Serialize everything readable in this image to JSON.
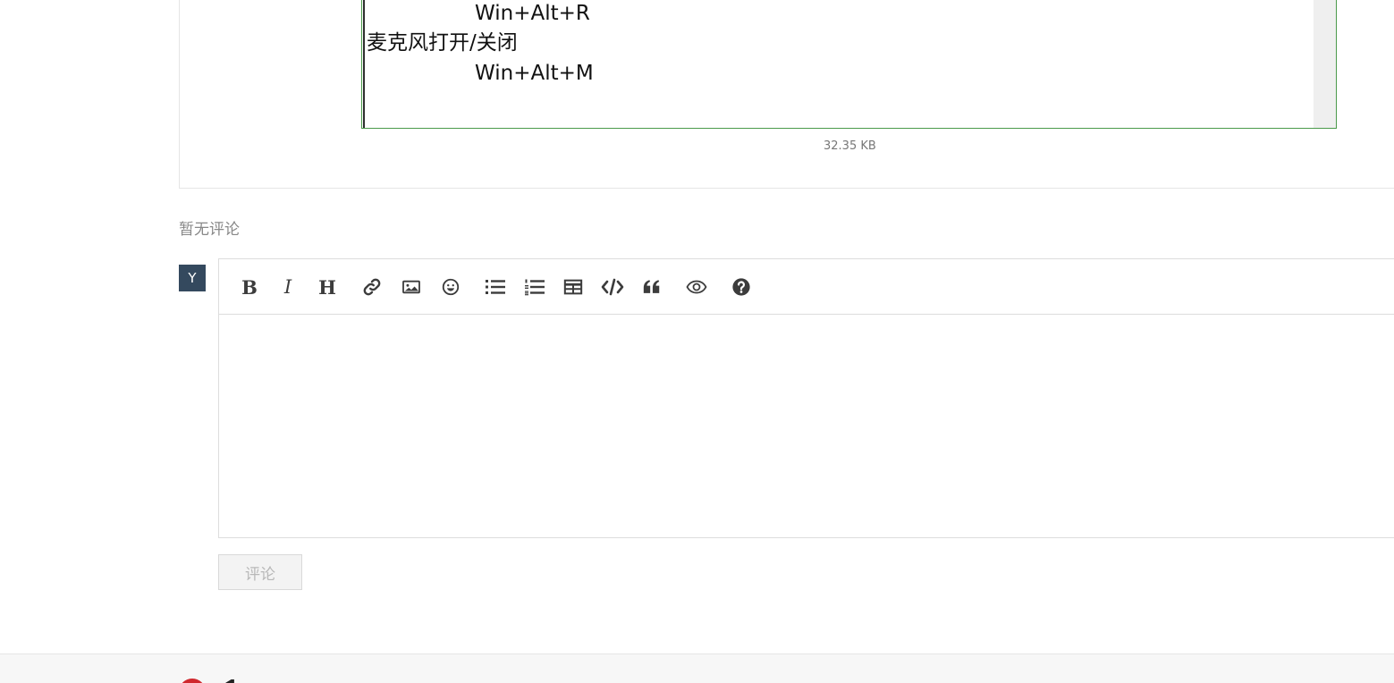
{
  "post": {
    "attachment_lines": {
      "line1": "Win+Alt+R",
      "line2": "麦克风打开/关闭",
      "line3": "Win+Alt+M"
    },
    "file_size": "32.35 KB"
  },
  "comments": {
    "empty_text": "暂无评论"
  },
  "composer": {
    "avatar_letter": "Y",
    "toolbar": [
      {
        "name": "bold-icon",
        "glyph": "B"
      },
      {
        "name": "italic-icon",
        "glyph": "I"
      },
      {
        "name": "heading-icon",
        "glyph": "H"
      },
      {
        "name": "link-icon"
      },
      {
        "name": "image-icon"
      },
      {
        "name": "emoji-icon"
      },
      {
        "name": "bullet-list-icon"
      },
      {
        "name": "numbered-list-icon"
      },
      {
        "name": "table-icon"
      },
      {
        "name": "code-icon"
      },
      {
        "name": "quote-icon"
      },
      {
        "name": "preview-icon"
      },
      {
        "name": "help-icon"
      }
    ],
    "editor_value": "",
    "submit_label": "评论"
  }
}
